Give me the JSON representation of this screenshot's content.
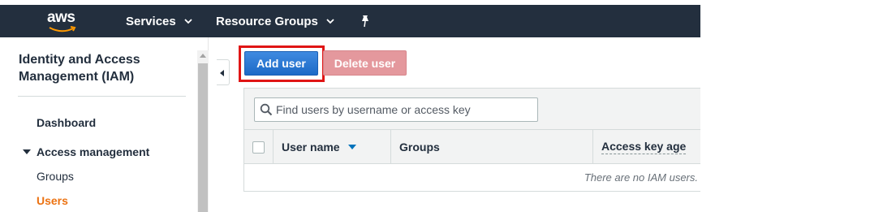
{
  "topnav": {
    "logo_text": "aws",
    "services_label": "Services",
    "resource_groups_label": "Resource Groups"
  },
  "sidebar": {
    "title": "Identity and Access Management (IAM)",
    "items": [
      {
        "label": "Dashboard"
      },
      {
        "label": "Access management"
      },
      {
        "label": "Groups"
      },
      {
        "label": "Users",
        "active": true
      }
    ]
  },
  "actions": {
    "add_user_label": "Add user",
    "delete_user_label": "Delete user"
  },
  "search": {
    "placeholder": "Find users by username or access key",
    "value": ""
  },
  "table": {
    "columns": [
      "User name",
      "Groups",
      "Access key age"
    ],
    "empty_message": "There are no IAM users."
  },
  "colors": {
    "nav_bg": "#232f3e",
    "accent_orange": "#ec7211",
    "primary_blue": "#1c6ac7",
    "highlight_red": "#e01515",
    "delete_disabled": "#e4989d"
  },
  "icons": [
    "aws-smile-icon",
    "chevron-down-icon",
    "pin-icon",
    "search-icon",
    "caret-down-icon",
    "sort-desc-icon",
    "collapse-left-icon"
  ]
}
